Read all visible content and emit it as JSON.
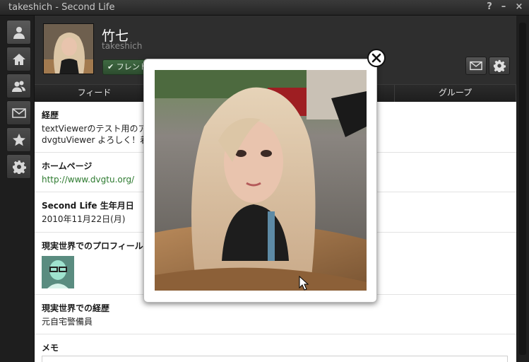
{
  "window": {
    "title": "takeshich - Second Life",
    "help_label": "?",
    "minimize_label": "–",
    "close_label": "×"
  },
  "sidebar": {
    "items": [
      {
        "icon": "person-icon",
        "name": "Profile"
      },
      {
        "icon": "home-icon",
        "name": "Home"
      },
      {
        "icon": "people-icon",
        "name": "People"
      },
      {
        "icon": "envelope-icon",
        "name": "Messages"
      },
      {
        "icon": "star-icon",
        "name": "Favorites"
      },
      {
        "icon": "gear-icon",
        "name": "Settings"
      }
    ]
  },
  "profile": {
    "display_name": "竹七",
    "username": "takeshich",
    "friend_button_label": "フレンド"
  },
  "tabs": [
    {
      "label": "フィード"
    },
    {
      "label": ""
    },
    {
      "label": ""
    },
    {
      "label": "グループ"
    }
  ],
  "sections": {
    "bio": {
      "label": "経歴",
      "line1": "textViewerのテスト用のアバ",
      "line2": "dvgtuViewer よろしく！着せ"
    },
    "homepage": {
      "label": "ホームページ",
      "url": "http://www.dvgtu.org/"
    },
    "birthdate": {
      "label": "Second Life 生年月日",
      "value": "2010年11月22日(月)"
    },
    "rl_profile": {
      "label": "現実世界でのプロフィール"
    },
    "rl_bio": {
      "label": "現実世界での経歴",
      "value": "元自宅警備員"
    },
    "memo": {
      "label": "メモ"
    }
  },
  "colors": {
    "friend_button": "#3f6a42",
    "link": "#2d7a2f",
    "dark_bg": "#2a2a2a"
  }
}
